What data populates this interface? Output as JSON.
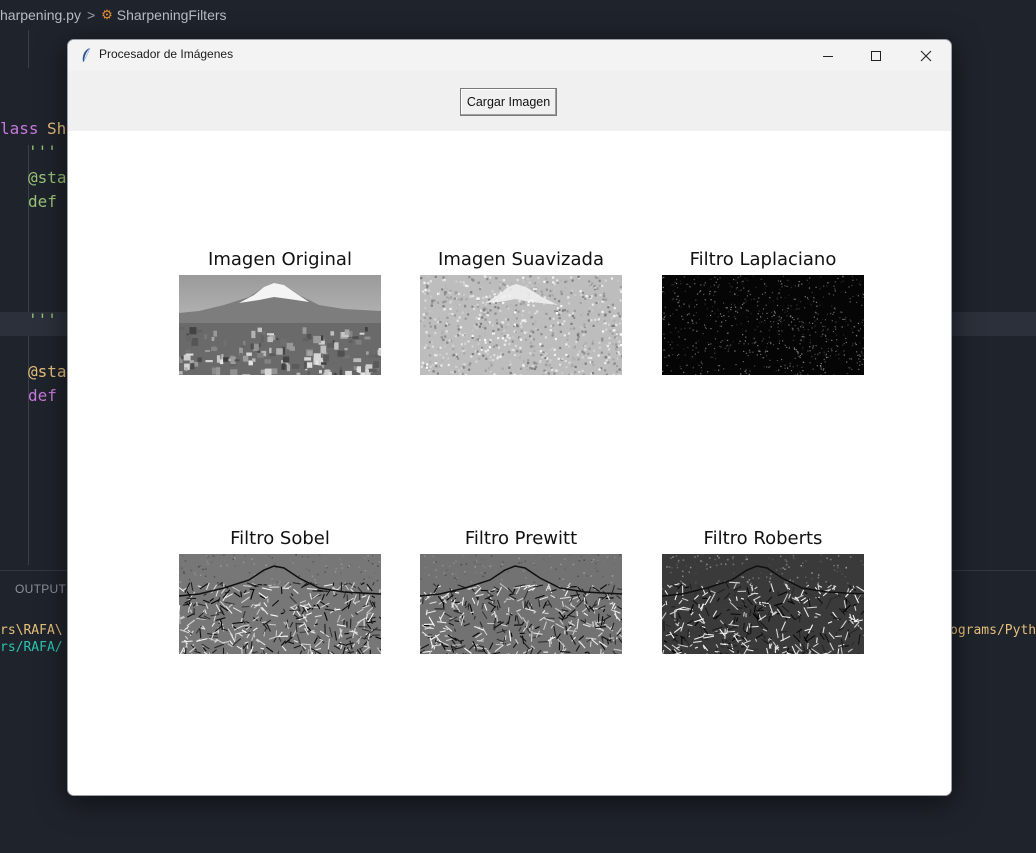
{
  "editor": {
    "breadcrumb": {
      "file": "harpening.py",
      "separator": ">",
      "symbol": "SharpeningFilters"
    },
    "code_lines": [
      {
        "text": "lass",
        "color": "#c678dd"
      },
      {
        "text": "Sh",
        "color": "#e5c07b"
      },
      {
        "text": "'''",
        "color": "#98c379"
      },
      {
        "text": "@sta",
        "color": "#98c379"
      },
      {
        "text": "def",
        "color": "#98c379"
      },
      {
        "text": "'''",
        "color": "#98c379"
      },
      {
        "text": "@sta",
        "color": "#e5c07b"
      },
      {
        "text": "def",
        "color": "#c678dd"
      }
    ],
    "panel_tab": "OUTPUT",
    "terminal_lines": [
      {
        "text": "rs\\RAFA\\",
        "color": "#e5c07b"
      },
      {
        "text": "rs/RAFA/",
        "color": "#2bc4b0"
      },
      {
        "text": "ograms/Pyth",
        "color": "#e5c07b"
      }
    ]
  },
  "window": {
    "title": "Procesador de Imágenes",
    "controls": {
      "minimize": "minimize-icon",
      "maximize": "maximize-icon",
      "close": "close-icon"
    },
    "load_button": "Cargar Imagen",
    "panels": [
      {
        "label": "Imagen Original",
        "kind": "original"
      },
      {
        "label": "Imagen Suavizada",
        "kind": "smoothed"
      },
      {
        "label": "Filtro Laplaciano",
        "kind": "laplacian"
      },
      {
        "label": "Filtro Sobel",
        "kind": "sobel"
      },
      {
        "label": "Filtro Prewitt",
        "kind": "prewitt"
      },
      {
        "label": "Filtro Roberts",
        "kind": "roberts"
      }
    ]
  }
}
